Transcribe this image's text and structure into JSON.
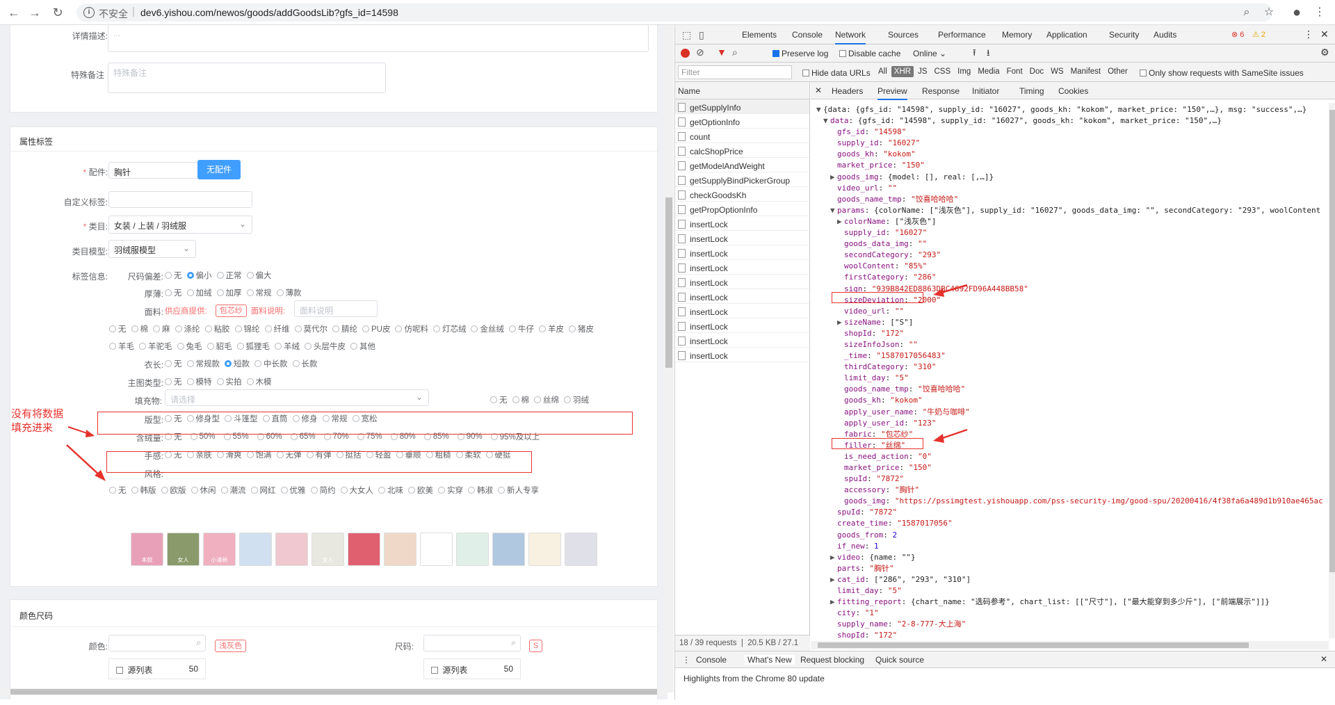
{
  "browser": {
    "insecure": "不安全",
    "url": "dev6.yishou.com/newos/goods/addGoodsLib?gfs_id=14598"
  },
  "form": {
    "detail_label": "详情描述:",
    "detail_placeholder": "...",
    "remark_label": "特殊备注",
    "remark_placeholder": "特殊备注",
    "attr_title": "属性标签",
    "accessory_label": "配件:",
    "accessory_value": "胸针",
    "no_accessory_btn": "无配件",
    "custom_tag_label": "自定义标签:",
    "category_label": "类目:",
    "category_value": "女装 / 上装 / 羽绒服",
    "model_label": "类目模型:",
    "model_value": "羽绒服模型",
    "tag_info_label": "标签信息:",
    "size_dev_label": "尺码偏差:",
    "size_dev": [
      "无",
      "偏小",
      "正常",
      "偏大"
    ],
    "size_dev_selected": "偏小",
    "thickness_label": "厚薄:",
    "thickness": [
      "无",
      "加绒",
      "加厚",
      "常规",
      "薄款"
    ],
    "fabric_label": "面料:",
    "fabric_supplier": "供应商提供:",
    "fabric_tag": "包芯纱",
    "fabric_desc_label": "面料说明:",
    "fabric_desc_placeholder": "面料说明",
    "fabric_row1": [
      "无",
      "棉",
      "麻",
      "涤纶",
      "粘胶",
      "锦纶",
      "纤维",
      "莫代尔",
      "腈纶",
      "PU皮",
      "仿呢料",
      "灯芯绒",
      "金丝绒",
      "牛仔",
      "羊皮",
      "猪皮"
    ],
    "fabric_row2": [
      "羊毛",
      "羊驼毛",
      "兔毛",
      "貂毛",
      "狐狸毛",
      "羊绒",
      "头层牛皮",
      "其他"
    ],
    "length_label": "衣长:",
    "length": [
      "无",
      "常规款",
      "短款",
      "中长款",
      "长款"
    ],
    "length_selected": "短款",
    "main_type_label": "主图类型:",
    "main_type": [
      "无",
      "模特",
      "实拍",
      "木模"
    ],
    "filler_label": "填充物:",
    "filler_placeholder": "请选择",
    "filler": [
      "无",
      "棉",
      "丝绵",
      "羽绒"
    ],
    "fit_label": "版型:",
    "fit": [
      "无",
      "修身型",
      "斗篷型",
      "直筒",
      "修身",
      "常规",
      "宽松"
    ],
    "wool_label": "含绒量:",
    "wool": [
      "无",
      "50%",
      "55%",
      "60%",
      "65%",
      "70%",
      "75%",
      "80%",
      "85%",
      "90%",
      "95%及以上"
    ],
    "feel_label": "手感:",
    "feel": [
      "无",
      "亲肤",
      "滑爽",
      "饱满",
      "无弹",
      "有弹",
      "挺括",
      "轻盈",
      "垂顺",
      "粗糙",
      "柔软",
      "硬挺"
    ],
    "style_label": "风格:",
    "style": [
      "无",
      "韩版",
      "欧版",
      "休闲",
      "潮流",
      "网红",
      "优雅",
      "简约",
      "大女人",
      "北味",
      "欧美",
      "实穿",
      "韩淑",
      "新人专享"
    ],
    "thumb_captions": [
      "本款",
      "女人",
      "小清新",
      "",
      "",
      "女人",
      "",
      "",
      "",
      "",
      "",
      "",
      ""
    ],
    "color_size_title": "颜色尺码",
    "color_label": "颜色:",
    "color_tag": "浅灰色",
    "size_label": "尺码:",
    "size_tag": "S",
    "list_label": "源列表",
    "list_count": "50"
  },
  "annotation": {
    "line1": "没有将数据",
    "line2": "填充进来"
  },
  "devtools": {
    "tabs": [
      "Elements",
      "Console",
      "Network",
      "Sources",
      "Performance",
      "Memory",
      "Application",
      "Security",
      "Audits"
    ],
    "active_tab": "Network",
    "errors": "6",
    "warnings": "2",
    "preserve_log": "Preserve log",
    "disable_cache": "Disable cache",
    "online": "Online",
    "filter_placeholder": "Filter",
    "hide_data_urls": "Hide data URLs",
    "types": [
      "All",
      "XHR",
      "JS",
      "CSS",
      "Img",
      "Media",
      "Font",
      "Doc",
      "WS",
      "Manifest",
      "Other"
    ],
    "samesite": "Only show requests with SameSite issues",
    "name_header": "Name",
    "requests": [
      "getSupplyInfo",
      "getOptionInfo",
      "count",
      "calcShopPrice",
      "getModelAndWeight",
      "getSupplyBindPickerGroup",
      "checkGoodsKh",
      "getPropOptionInfo",
      "insertLock",
      "insertLock",
      "insertLock",
      "insertLock",
      "insertLock",
      "insertLock",
      "insertLock",
      "insertLock",
      "insertLock",
      "insertLock"
    ],
    "status_requests": "18 / 39 requests",
    "status_size": "20.5 KB / 27.1",
    "preview_tabs": [
      "Headers",
      "Preview",
      "Response",
      "Initiator",
      "Timing",
      "Cookies"
    ],
    "active_preview": "Preview",
    "drawer_tabs": [
      "Console",
      "What's New",
      "Request blocking",
      "Quick source"
    ],
    "drawer_text": "Highlights from the Chrome 80 update"
  },
  "json_lines": [
    {
      "i": 0,
      "t": "▼",
      "k": "",
      "v": "{data: {gfs_id: \"14598\", supply_id: \"16027\", goods_kh: \"kokom\", market_price: \"150\",…}, msg: \"success\",…}",
      "c": "jr"
    },
    {
      "i": 1,
      "t": "▼",
      "k": "data",
      "v": "{gfs_id: \"14598\", supply_id: \"16027\", goods_kh: \"kokom\", market_price: \"150\",…}",
      "c": "jr"
    },
    {
      "i": 2,
      "t": "",
      "k": "gfs_id",
      "v": "\"14598\"",
      "c": "js"
    },
    {
      "i": 2,
      "t": "",
      "k": "supply_id",
      "v": "\"16027\"",
      "c": "js"
    },
    {
      "i": 2,
      "t": "",
      "k": "goods_kh",
      "v": "\"kokom\"",
      "c": "js"
    },
    {
      "i": 2,
      "t": "",
      "k": "market_price",
      "v": "\"150\"",
      "c": "js"
    },
    {
      "i": 2,
      "t": "▶",
      "k": "goods_img",
      "v": "{model: [], real: [,…]}",
      "c": "jr"
    },
    {
      "i": 2,
      "t": "",
      "k": "video_url",
      "v": "\"\"",
      "c": "js"
    },
    {
      "i": 2,
      "t": "",
      "k": "goods_name_tmp",
      "v": "\"饺喜哈哈哈\"",
      "c": "js"
    },
    {
      "i": 2,
      "t": "▼",
      "k": "params",
      "v": "{colorName: [\"浅灰色\"], supply_id: \"16027\", goods_data_img: \"\", secondCategory: \"293\", woolContent",
      "c": "jr"
    },
    {
      "i": 3,
      "t": "▶",
      "k": "colorName",
      "v": "[\"浅灰色\"]",
      "c": "jr"
    },
    {
      "i": 3,
      "t": "",
      "k": "supply_id",
      "v": "\"16027\"",
      "c": "js"
    },
    {
      "i": 3,
      "t": "",
      "k": "goods_data_img",
      "v": "\"\"",
      "c": "js"
    },
    {
      "i": 3,
      "t": "",
      "k": "secondCategory",
      "v": "\"293\"",
      "c": "js"
    },
    {
      "i": 3,
      "t": "",
      "k": "woolContent",
      "v": "\"85%\"",
      "c": "js"
    },
    {
      "i": 3,
      "t": "",
      "k": "firstCategory",
      "v": "\"286\"",
      "c": "js"
    },
    {
      "i": 3,
      "t": "",
      "k": "sign",
      "v": "\"939B842ED8863DBC4692FD96A448BB58\"",
      "c": "js"
    },
    {
      "i": 3,
      "t": "",
      "k": "sizeDeviation",
      "v": "\"2000\"",
      "c": "js"
    },
    {
      "i": 3,
      "t": "",
      "k": "video_url",
      "v": "\"\"",
      "c": "js"
    },
    {
      "i": 3,
      "t": "▶",
      "k": "sizeName",
      "v": "[\"S\"]",
      "c": "jr"
    },
    {
      "i": 3,
      "t": "",
      "k": "shopId",
      "v": "\"172\"",
      "c": "js"
    },
    {
      "i": 3,
      "t": "",
      "k": "sizeInfoJson",
      "v": "\"\"",
      "c": "js"
    },
    {
      "i": 3,
      "t": "",
      "k": "_time",
      "v": "\"1587017056483\"",
      "c": "js"
    },
    {
      "i": 3,
      "t": "",
      "k": "thirdCategory",
      "v": "\"310\"",
      "c": "js"
    },
    {
      "i": 3,
      "t": "",
      "k": "limit_day",
      "v": "\"5\"",
      "c": "js"
    },
    {
      "i": 3,
      "t": "",
      "k": "goods_name_tmp",
      "v": "\"饺喜哈哈哈\"",
      "c": "js"
    },
    {
      "i": 3,
      "t": "",
      "k": "goods_kh",
      "v": "\"kokom\"",
      "c": "js"
    },
    {
      "i": 3,
      "t": "",
      "k": "apply_user_name",
      "v": "\"牛奶与咖啡\"",
      "c": "js"
    },
    {
      "i": 3,
      "t": "",
      "k": "apply_user_id",
      "v": "\"123\"",
      "c": "js"
    },
    {
      "i": 3,
      "t": "",
      "k": "fabric",
      "v": "\"包芯纱\"",
      "c": "js"
    },
    {
      "i": 3,
      "t": "",
      "k": "filler",
      "v": "\"丝绵\"",
      "c": "js"
    },
    {
      "i": 3,
      "t": "",
      "k": "is_need_action",
      "v": "\"0\"",
      "c": "js"
    },
    {
      "i": 3,
      "t": "",
      "k": "market_price",
      "v": "\"150\"",
      "c": "js"
    },
    {
      "i": 3,
      "t": "",
      "k": "spuId",
      "v": "\"7872\"",
      "c": "js"
    },
    {
      "i": 3,
      "t": "",
      "k": "accessory",
      "v": "\"胸针\"",
      "c": "js"
    },
    {
      "i": 3,
      "t": "",
      "k": "goods_img",
      "v": "\"https://pssimgtest.yishouapp.com/pss-security-img/good-spu/20200416/4f38fa6a489d1b910ae465ac",
      "c": "js"
    },
    {
      "i": 2,
      "t": "",
      "k": "spuId",
      "v": "\"7872\"",
      "c": "js"
    },
    {
      "i": 2,
      "t": "",
      "k": "create_time",
      "v": "\"1587017056\"",
      "c": "js"
    },
    {
      "i": 2,
      "t": "",
      "k": "goods_from",
      "v": "2",
      "c": "jn"
    },
    {
      "i": 2,
      "t": "",
      "k": "if_new",
      "v": "1",
      "c": "jn"
    },
    {
      "i": 2,
      "t": "▶",
      "k": "video",
      "v": "{name: \"\"}",
      "c": "jr"
    },
    {
      "i": 2,
      "t": "",
      "k": "parts",
      "v": "\"胸针\"",
      "c": "js"
    },
    {
      "i": 2,
      "t": "▶",
      "k": "cat_id",
      "v": "[\"286\", \"293\", \"310\"]",
      "c": "jr"
    },
    {
      "i": 2,
      "t": "",
      "k": "limit_day",
      "v": "\"5\"",
      "c": "js"
    },
    {
      "i": 2,
      "t": "▶",
      "k": "fitting_report",
      "v": "{chart_name: \"选码参考\", chart_list: [[\"尺寸\"], [\"最大能穿到多少斤\"], [\"前端展示\"]]}",
      "c": "jr"
    },
    {
      "i": 2,
      "t": "",
      "k": "city",
      "v": "\"1\"",
      "c": "js"
    },
    {
      "i": 2,
      "t": "",
      "k": "supply_name",
      "v": "\"2-8-777-大上海\"",
      "c": "js"
    },
    {
      "i": 2,
      "t": "",
      "k": "shopId",
      "v": "\"172\"",
      "c": "js"
    }
  ]
}
